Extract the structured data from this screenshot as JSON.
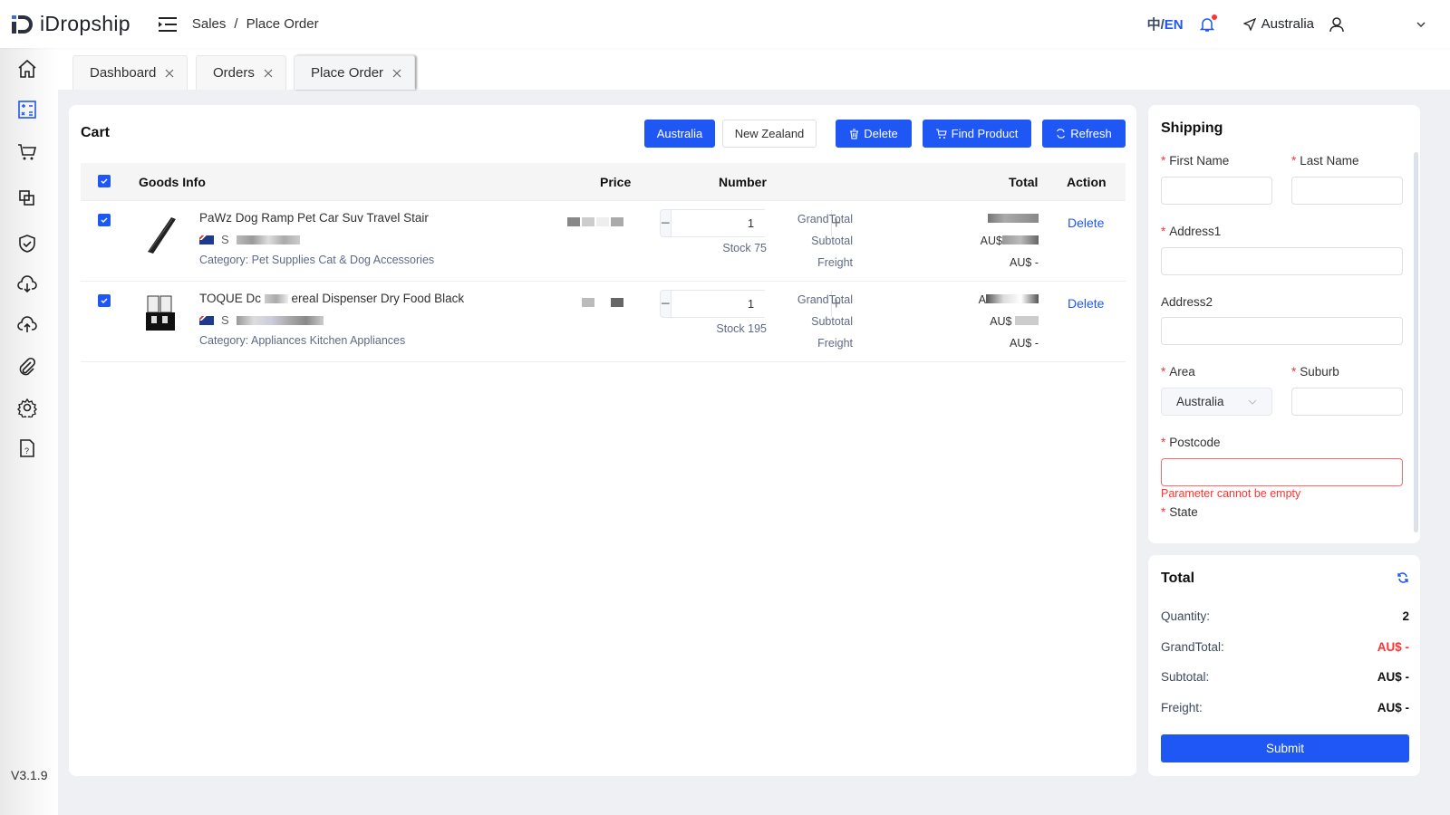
{
  "app": {
    "name": "iDropship",
    "version": "V3.1.9"
  },
  "header": {
    "breadcrumb": [
      "Sales",
      "/",
      "Place Order"
    ],
    "lang_cn": "中/",
    "lang_en": "EN",
    "location": "Australia",
    "notification_dot_color": "#ff3333"
  },
  "sidebar": {
    "items": [
      {
        "icon": "home-icon"
      },
      {
        "icon": "calculator-icon",
        "active": true
      },
      {
        "icon": "cart-icon"
      },
      {
        "icon": "copy-icon"
      },
      {
        "icon": "shield-check-icon"
      },
      {
        "icon": "cloud-download-icon"
      },
      {
        "icon": "cloud-upload-icon"
      },
      {
        "icon": "paperclip-icon"
      },
      {
        "icon": "settings-icon"
      },
      {
        "icon": "help-document-icon"
      }
    ]
  },
  "tabs": [
    {
      "label": "Dashboard"
    },
    {
      "label": "Orders"
    },
    {
      "label": "Place Order",
      "active": true
    }
  ],
  "cart": {
    "title": "Cart",
    "buttons": {
      "australia": "Australia",
      "new_zealand": "New Zealand",
      "delete": "Delete",
      "find_product": "Find Product",
      "refresh": "Refresh"
    },
    "columns": {
      "goods_info": "Goods Info",
      "price": "Price",
      "number": "Number",
      "total": "Total",
      "action": "Action"
    },
    "rows": [
      {
        "name_before": "PaWz Dog Ramp Pet Car Suv Travel Stair",
        "name_after": "",
        "sku_prefix": "S",
        "category": "Category: Pet Supplies Cat & Dog Accessories",
        "quantity": "1",
        "stock": "Stock 75",
        "grandtotal_label": "GrandTotal",
        "subtotal_label": "Subtotal",
        "freight_label": "Freight",
        "grandtotal_value": "",
        "subtotal_value": "AU$",
        "freight_value": "AU$ -",
        "action": "Delete"
      },
      {
        "name_before": "TOQUE Dc",
        "name_after": "ereal Dispenser Dry Food Black",
        "sku_prefix": "S",
        "category": "Category: Appliances Kitchen Appliances",
        "quantity": "1",
        "stock": "Stock 195",
        "grandtotal_label": "GrandTotal",
        "subtotal_label": "Subtotal",
        "freight_label": "Freight",
        "grandtotal_value": "A",
        "subtotal_value": "AU$",
        "freight_value": "AU$ -",
        "action": "Delete"
      }
    ]
  },
  "shipping": {
    "title": "Shipping",
    "fields": {
      "first_name": {
        "label": "First Name",
        "value": ""
      },
      "last_name": {
        "label": "Last Name",
        "value": ""
      },
      "address1": {
        "label": "Address1",
        "value": ""
      },
      "address2": {
        "label": "Address2",
        "value": ""
      },
      "area": {
        "label": "Area",
        "value": "Australia"
      },
      "suburb": {
        "label": "Suburb",
        "value": ""
      },
      "postcode": {
        "label": "Postcode",
        "value": "",
        "error": "Parameter cannot be empty"
      },
      "state": {
        "label": "State"
      }
    }
  },
  "total": {
    "title": "Total",
    "quantity_label": "Quantity:",
    "quantity_value": "2",
    "grandtotal_label": "GrandTotal:",
    "grandtotal_value": "AU$ -",
    "subtotal_label": "Subtotal:",
    "subtotal_value": "AU$ -",
    "freight_label": "Freight:",
    "freight_value": "AU$ -",
    "submit": "Submit"
  },
  "colors": {
    "primary": "#1f57f5",
    "error": "#ff3333"
  }
}
